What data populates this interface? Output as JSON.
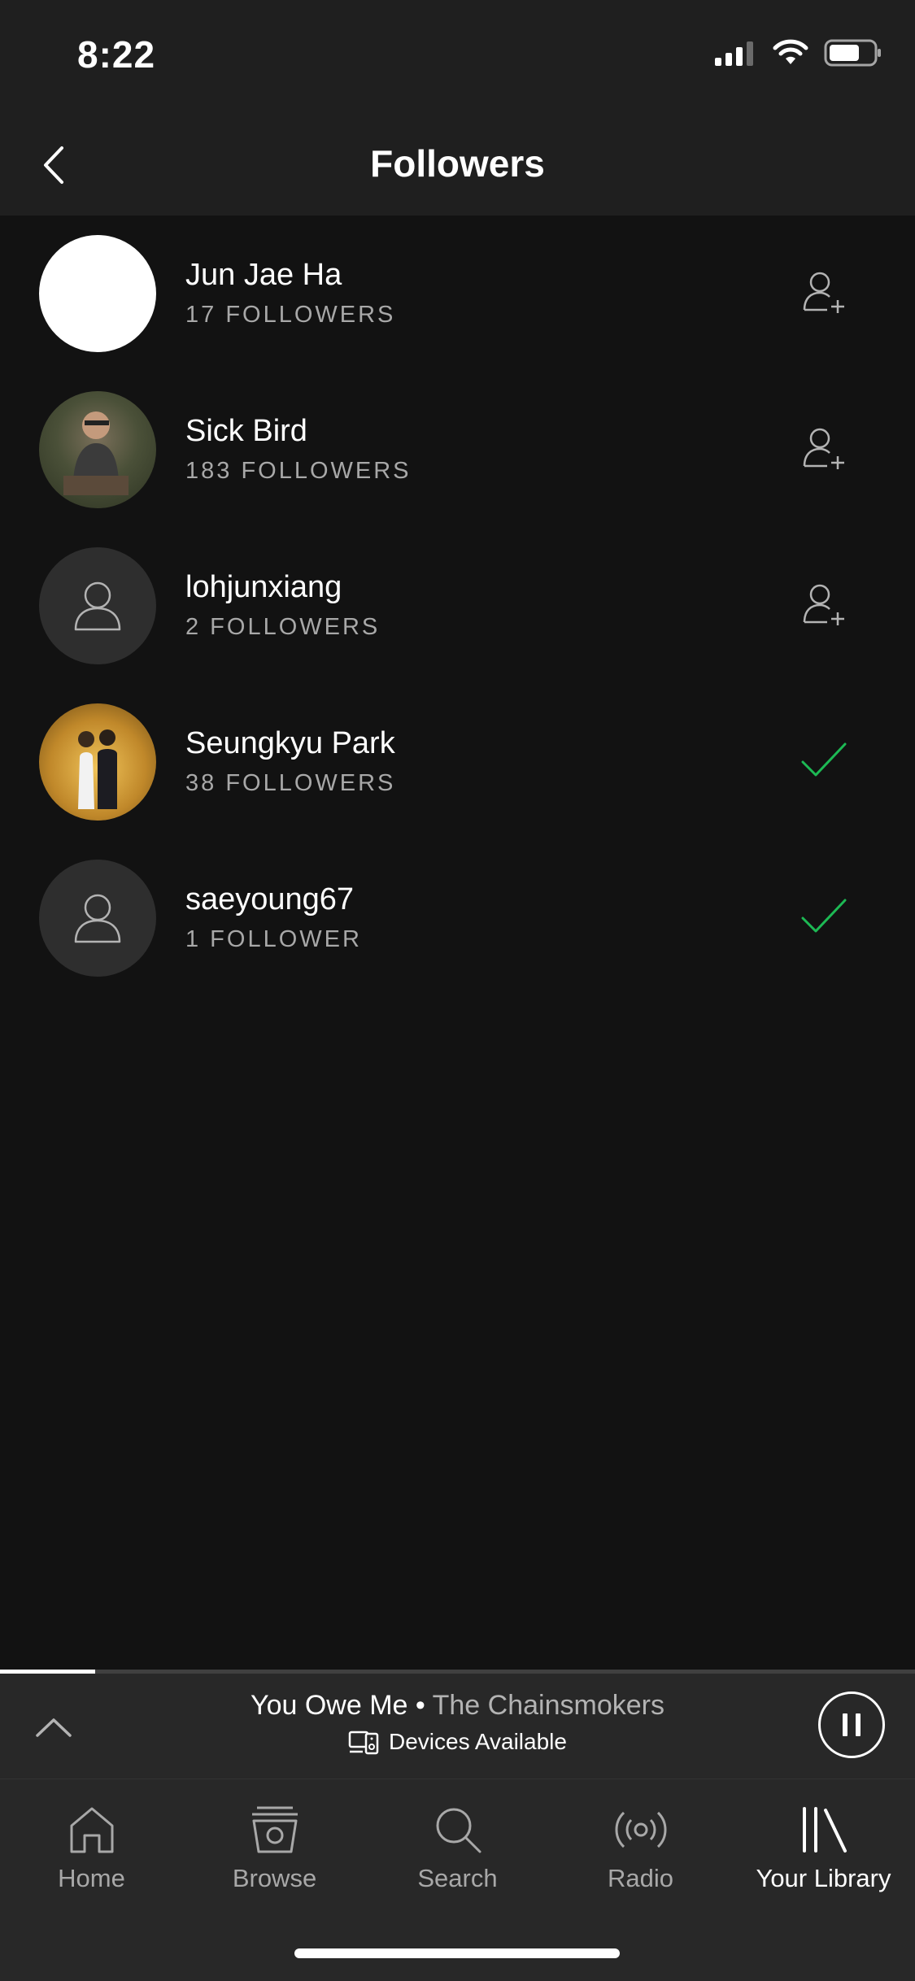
{
  "status_bar": {
    "time": "8:22"
  },
  "header": {
    "title": "Followers"
  },
  "followers": [
    {
      "name": "Jun Jae Ha",
      "followers": "17 FOLLOWERS",
      "avatar": "white",
      "following": false
    },
    {
      "name": "Sick Bird",
      "followers": "183 FOLLOWERS",
      "avatar": "photo",
      "following": false
    },
    {
      "name": "lohjunxiang",
      "followers": "2 FOLLOWERS",
      "avatar": "placeholder",
      "following": false
    },
    {
      "name": "Seungkyu Park",
      "followers": "38 FOLLOWERS",
      "avatar": "photo",
      "following": true
    },
    {
      "name": "saeyoung67",
      "followers": "1 FOLLOWER",
      "avatar": "placeholder",
      "following": true
    }
  ],
  "player": {
    "title": "You Owe Me",
    "separator": " • ",
    "artist": "The Chainsmokers",
    "devices": "Devices Available",
    "progress": 0.104
  },
  "tabs": [
    {
      "label": "Home",
      "icon": "home-icon"
    },
    {
      "label": "Browse",
      "icon": "browse-icon"
    },
    {
      "label": "Search",
      "icon": "search-icon"
    },
    {
      "label": "Radio",
      "icon": "radio-icon"
    },
    {
      "label": "Your Library",
      "icon": "library-icon",
      "active": true
    }
  ],
  "colors": {
    "background": "#121212",
    "bar": "#282828",
    "accent": "#1db954",
    "muted": "#a8a8a8"
  }
}
